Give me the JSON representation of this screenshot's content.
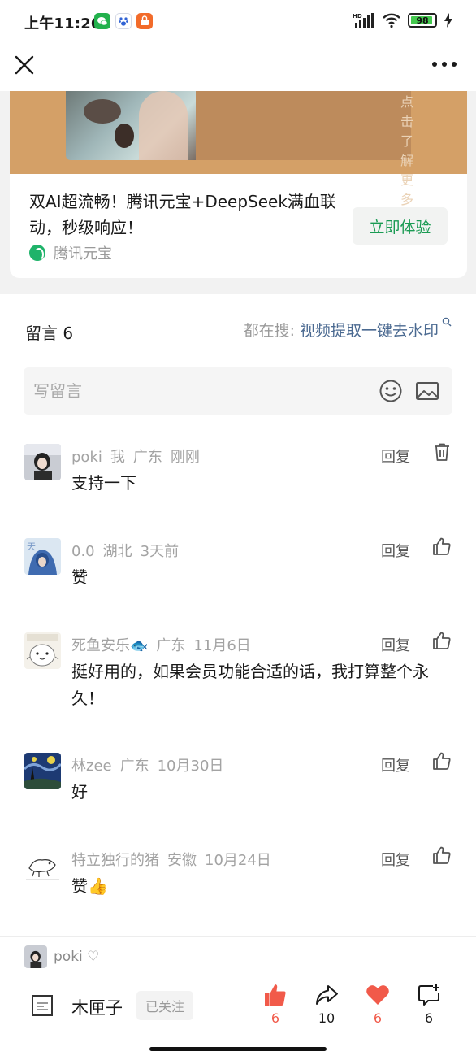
{
  "status_bar": {
    "time": "上午11:20",
    "battery": "98",
    "notifications": [
      "wechat-icon",
      "baidu-icon",
      "shop-icon"
    ]
  },
  "ad": {
    "learn_more": "点击了解更多 ›",
    "title": "双AI超流畅！腾讯元宝+DeepSeek满血联动，秒级响应！",
    "brand": "腾讯元宝",
    "cta": "立即体验"
  },
  "comments_header": {
    "title": "留言 6",
    "search_prefix": "都在搜:",
    "search_term": "视频提取一键去水印"
  },
  "write_box": {
    "placeholder": "写留言"
  },
  "comments": [
    {
      "user": "poki",
      "tag": "我",
      "region": "广东",
      "time": "刚刚",
      "text": "支持一下",
      "reply": "回复",
      "action": "delete-icon"
    },
    {
      "user": "0.0",
      "tag": "",
      "region": "湖北",
      "time": "3天前",
      "text": "赞",
      "reply": "回复",
      "action": "thumb-up-icon"
    },
    {
      "user": "死鱼安乐🐟",
      "tag": "",
      "region": "广东",
      "time": "11月6日",
      "text": "挺好用的，如果会员功能合适的话，我打算整个永久！",
      "reply": "回复",
      "action": "thumb-up-icon"
    },
    {
      "user": "林zee",
      "tag": "",
      "region": "广东",
      "time": "10月30日",
      "text": "好",
      "reply": "回复",
      "action": "thumb-up-icon"
    },
    {
      "user": "特立独行的猪",
      "tag": "",
      "region": "安徽",
      "time": "10月24日",
      "text": "赞👍",
      "reply": "回复",
      "action": "thumb-up-icon"
    }
  ],
  "bottom_bar": {
    "liker_name": "poki ♡",
    "author_name": "木匣子",
    "follow_label": "已关注",
    "stats": {
      "like": "6",
      "share": "10",
      "favorite": "6",
      "comment": "6"
    }
  },
  "colors": {
    "accent_green": "#1a9b53",
    "like_red": "#f15a4a",
    "link_blue": "#4b6a91"
  }
}
